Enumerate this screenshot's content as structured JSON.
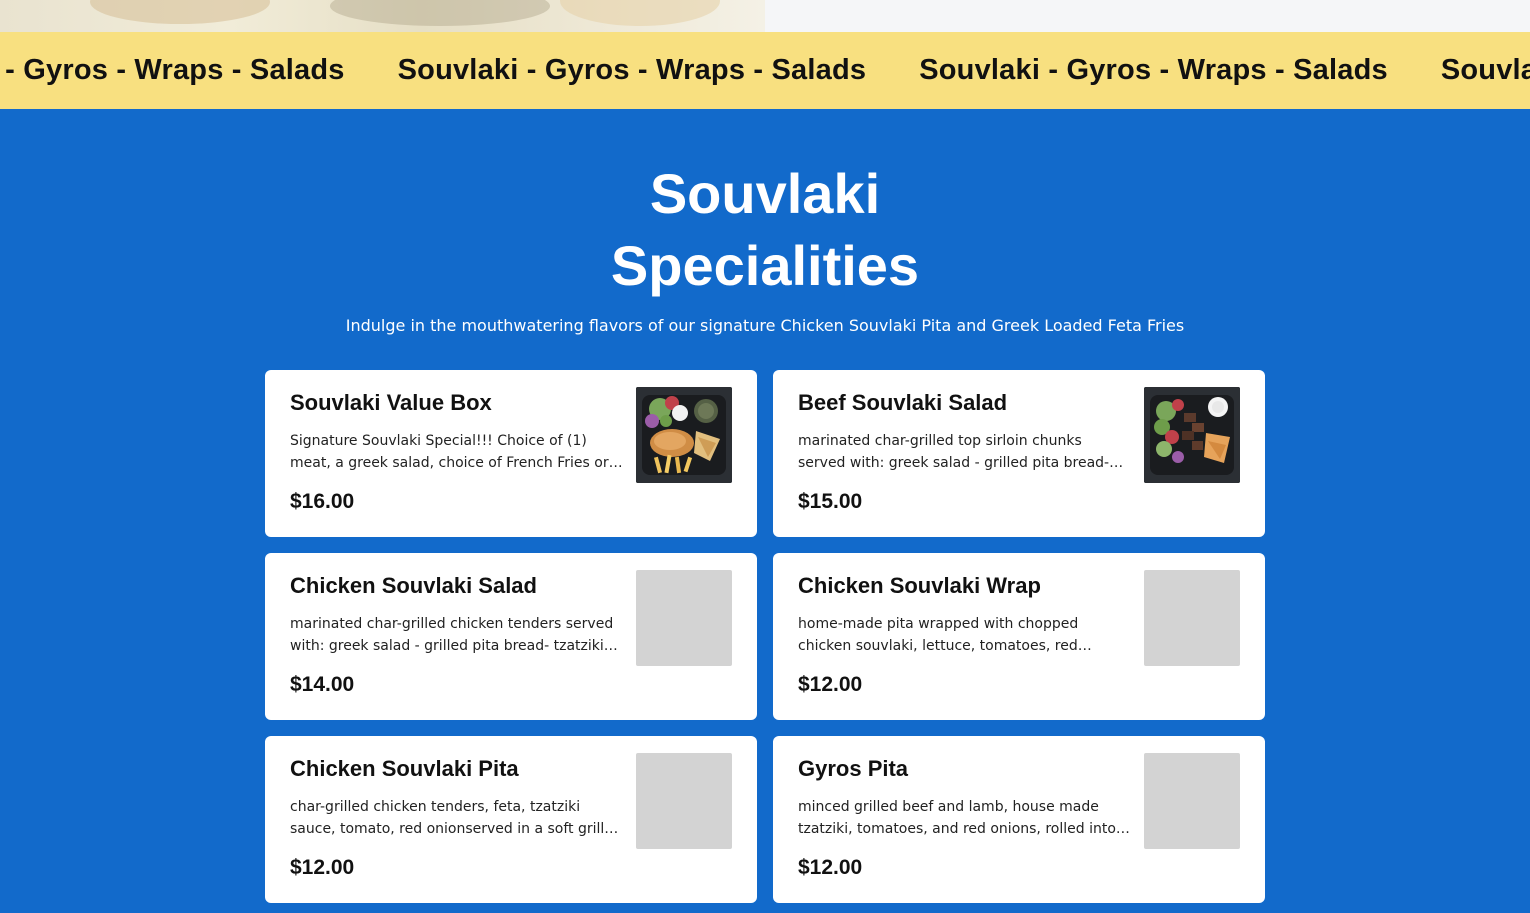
{
  "marquee": {
    "items": [
      "Souvlaki - Gyros - Wraps - Salads",
      "Souvlaki - Gyros - Wraps - Salads",
      "Souvlaki - Gyros - Wraps - Salads",
      "Souvlaki - Gyros - Wraps - Salads"
    ]
  },
  "section": {
    "title_line1": "Souvlaki",
    "title_line2": "Specialities",
    "subtitle": "Indulge in the mouthwatering flavors of our signature Chicken Souvlaki Pita and Greek Loaded Feta Fries"
  },
  "menu": {
    "items": [
      {
        "name": "Souvlaki Value Box",
        "description": "Signature Souvlaki Special!!! Choice of (1) meat, a greek salad, choice of French Fries or upgrade to Greek Loaded Feta Fries",
        "price": "$16.00",
        "image": "souvlaki-value-box-photo"
      },
      {
        "name": "Beef Souvlaki Salad",
        "description": "marinated char-grilled top sirloin chunks served with: greek salad - grilled pita bread- tzatziki sauce",
        "price": "$15.00",
        "image": "beef-souvlaki-salad-photo"
      },
      {
        "name": "Chicken Souvlaki Salad",
        "description": "marinated char-grilled chicken tenders served with: greek salad - grilled pita bread- tzatziki sauce",
        "price": "$14.00",
        "image": "placeholder"
      },
      {
        "name": "Chicken Souvlaki Wrap",
        "description": "home-made pita wrapped with chopped chicken souvlaki, lettuce, tomatoes, red onions, feta cheese and tzatziki",
        "price": "$12.00",
        "image": "placeholder"
      },
      {
        "name": "Chicken Souvlaki Pita",
        "description": "char-grilled chicken tenders, feta, tzatziki sauce, tomato, red onionserved in a soft grilled pita",
        "price": "$12.00",
        "image": "placeholder"
      },
      {
        "name": "Gyros Pita",
        "description": "minced grilled beef and lamb, house made tzatziki, tomatoes, and red onions, rolled into a soft grilled pita",
        "price": "$12.00",
        "image": "placeholder"
      }
    ]
  },
  "colors": {
    "page_background": "#126ACB",
    "marquee_background": "#F8E080",
    "card_background": "#FFFFFF",
    "image_placeholder": "#D3D3D3"
  }
}
